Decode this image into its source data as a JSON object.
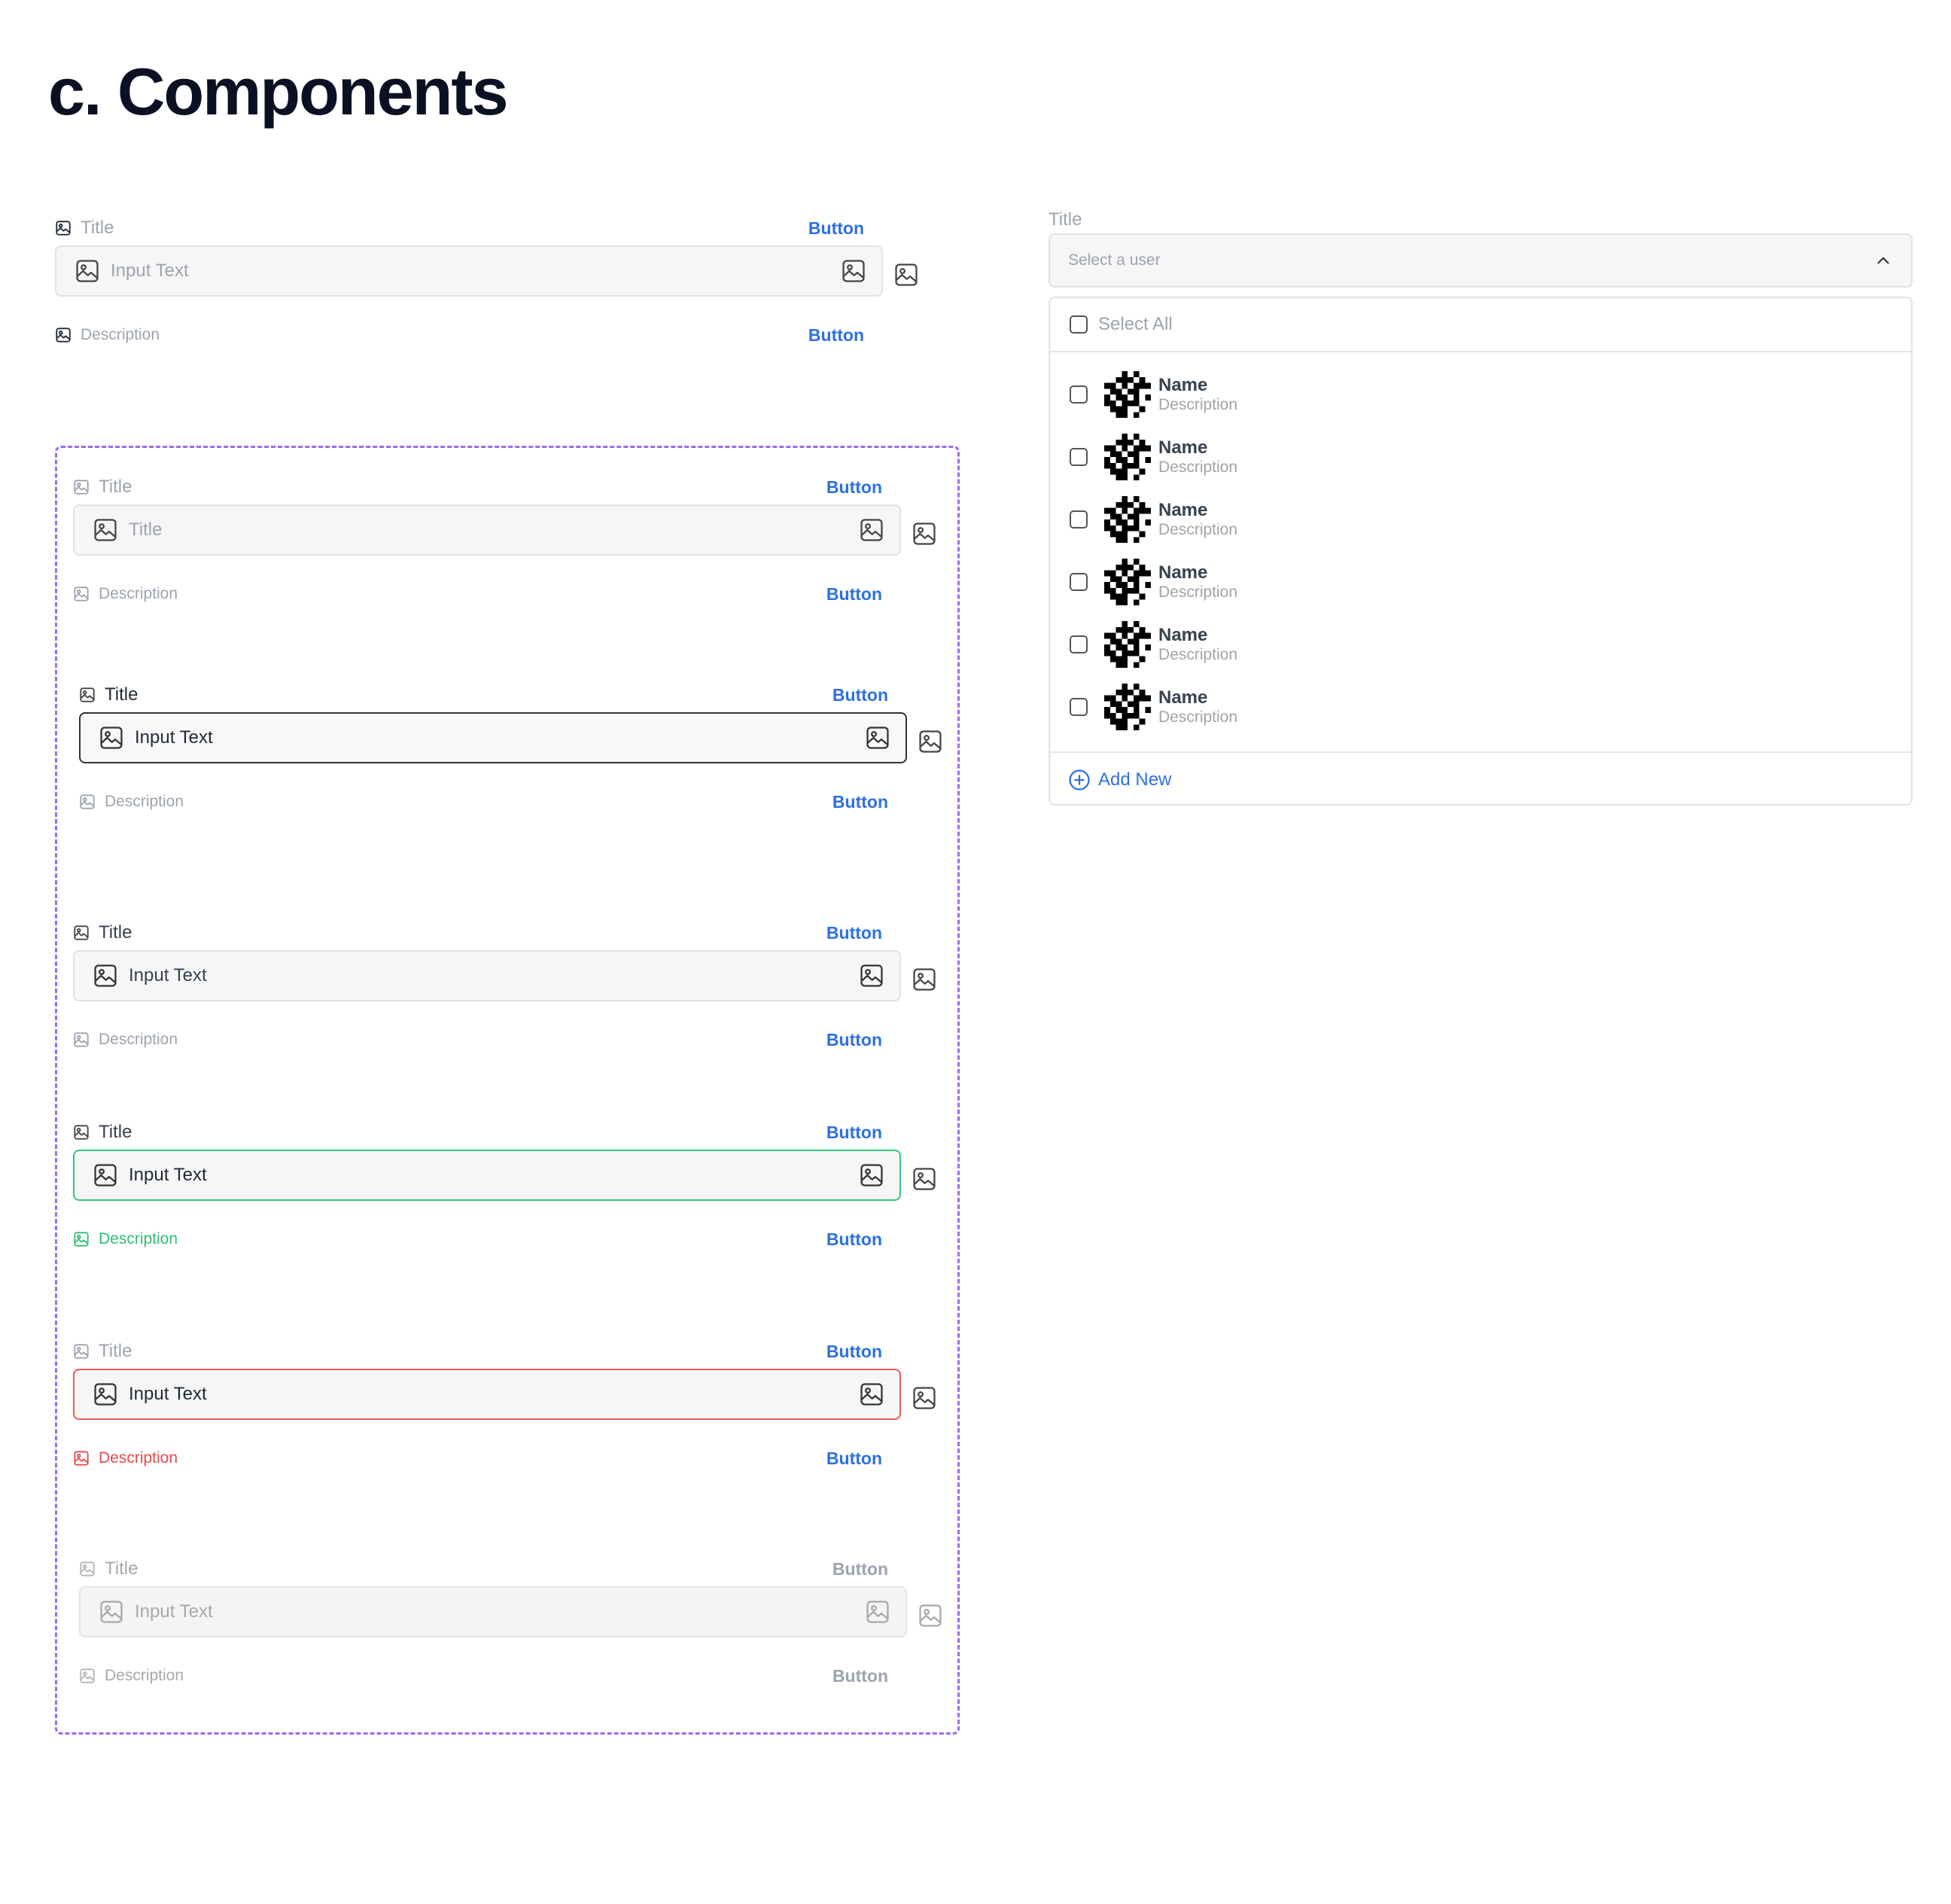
{
  "page": {
    "title": "c. Components"
  },
  "fields": [
    {
      "state": "default",
      "title": "Title",
      "value": "Input Text",
      "description": "Description",
      "top_button": "Button",
      "bottom_button": "Button"
    },
    {
      "state": "placeholder",
      "title": "Title",
      "value": "Title",
      "description": "Description",
      "top_button": "Button",
      "bottom_button": "Button"
    },
    {
      "state": "focus",
      "title": "Title",
      "value": "Input Text",
      "description": "Description",
      "top_button": "Button",
      "bottom_button": "Button"
    },
    {
      "state": "filled",
      "title": "Title",
      "value": "Input Text",
      "description": "Description",
      "top_button": "Button",
      "bottom_button": "Button"
    },
    {
      "state": "success",
      "title": "Title",
      "value": "Input Text",
      "description": "Description",
      "top_button": "Button",
      "bottom_button": "Button"
    },
    {
      "state": "error",
      "title": "Title",
      "value": "Input Text",
      "description": "Description",
      "top_button": "Button",
      "bottom_button": "Button"
    },
    {
      "state": "disabled",
      "title": "Title",
      "value": "Input Text",
      "description": "Description",
      "top_button": "Button",
      "bottom_button": "Button"
    }
  ],
  "dropdown": {
    "title": "Title",
    "placeholder": "Select a user",
    "select_all": "Select All",
    "users": [
      {
        "name": "Name",
        "description": "Description"
      },
      {
        "name": "Name",
        "description": "Description"
      },
      {
        "name": "Name",
        "description": "Description"
      },
      {
        "name": "Name",
        "description": "Description"
      },
      {
        "name": "Name",
        "description": "Description"
      },
      {
        "name": "Name",
        "description": "Description"
      }
    ],
    "add_new": "Add New"
  },
  "icons": {
    "field": "image-icon",
    "chevron": "chevron-up-icon",
    "add": "plus-circle-icon"
  },
  "colors": {
    "accent": "#2f6fe0",
    "success": "#34c77b",
    "error": "#ec5a5a",
    "frame": "#9b6bf2"
  }
}
